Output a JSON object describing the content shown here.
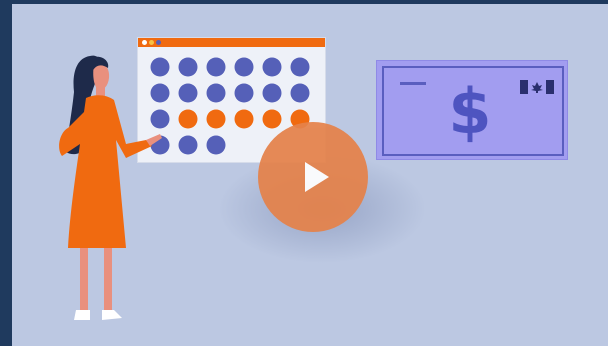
{
  "video": {
    "currency_symbol": "$",
    "controls": {
      "play": "play-icon"
    }
  },
  "colors": {
    "frame": "#1f3a5e",
    "background": "#bcc8e2",
    "calendar_header": "#f06a10",
    "calendar_dot_blue": "#5560b8",
    "calendar_dot_orange": "#f06a10",
    "bill_fill": "#a29df0",
    "bill_ink": "#4e54c0",
    "play_button": "#e5824a",
    "dress": "#f06a10",
    "hair": "#1e2a4a"
  },
  "calendar": {
    "rows": [
      [
        "blue",
        "blue",
        "blue",
        "blue",
        "blue",
        "blue"
      ],
      [
        "blue",
        "blue",
        "blue",
        "blue",
        "blue",
        "blue"
      ],
      [
        "blue",
        "orange",
        "orange",
        "orange",
        "orange",
        "orange"
      ],
      [
        "blue",
        "blue",
        "blue"
      ]
    ]
  }
}
